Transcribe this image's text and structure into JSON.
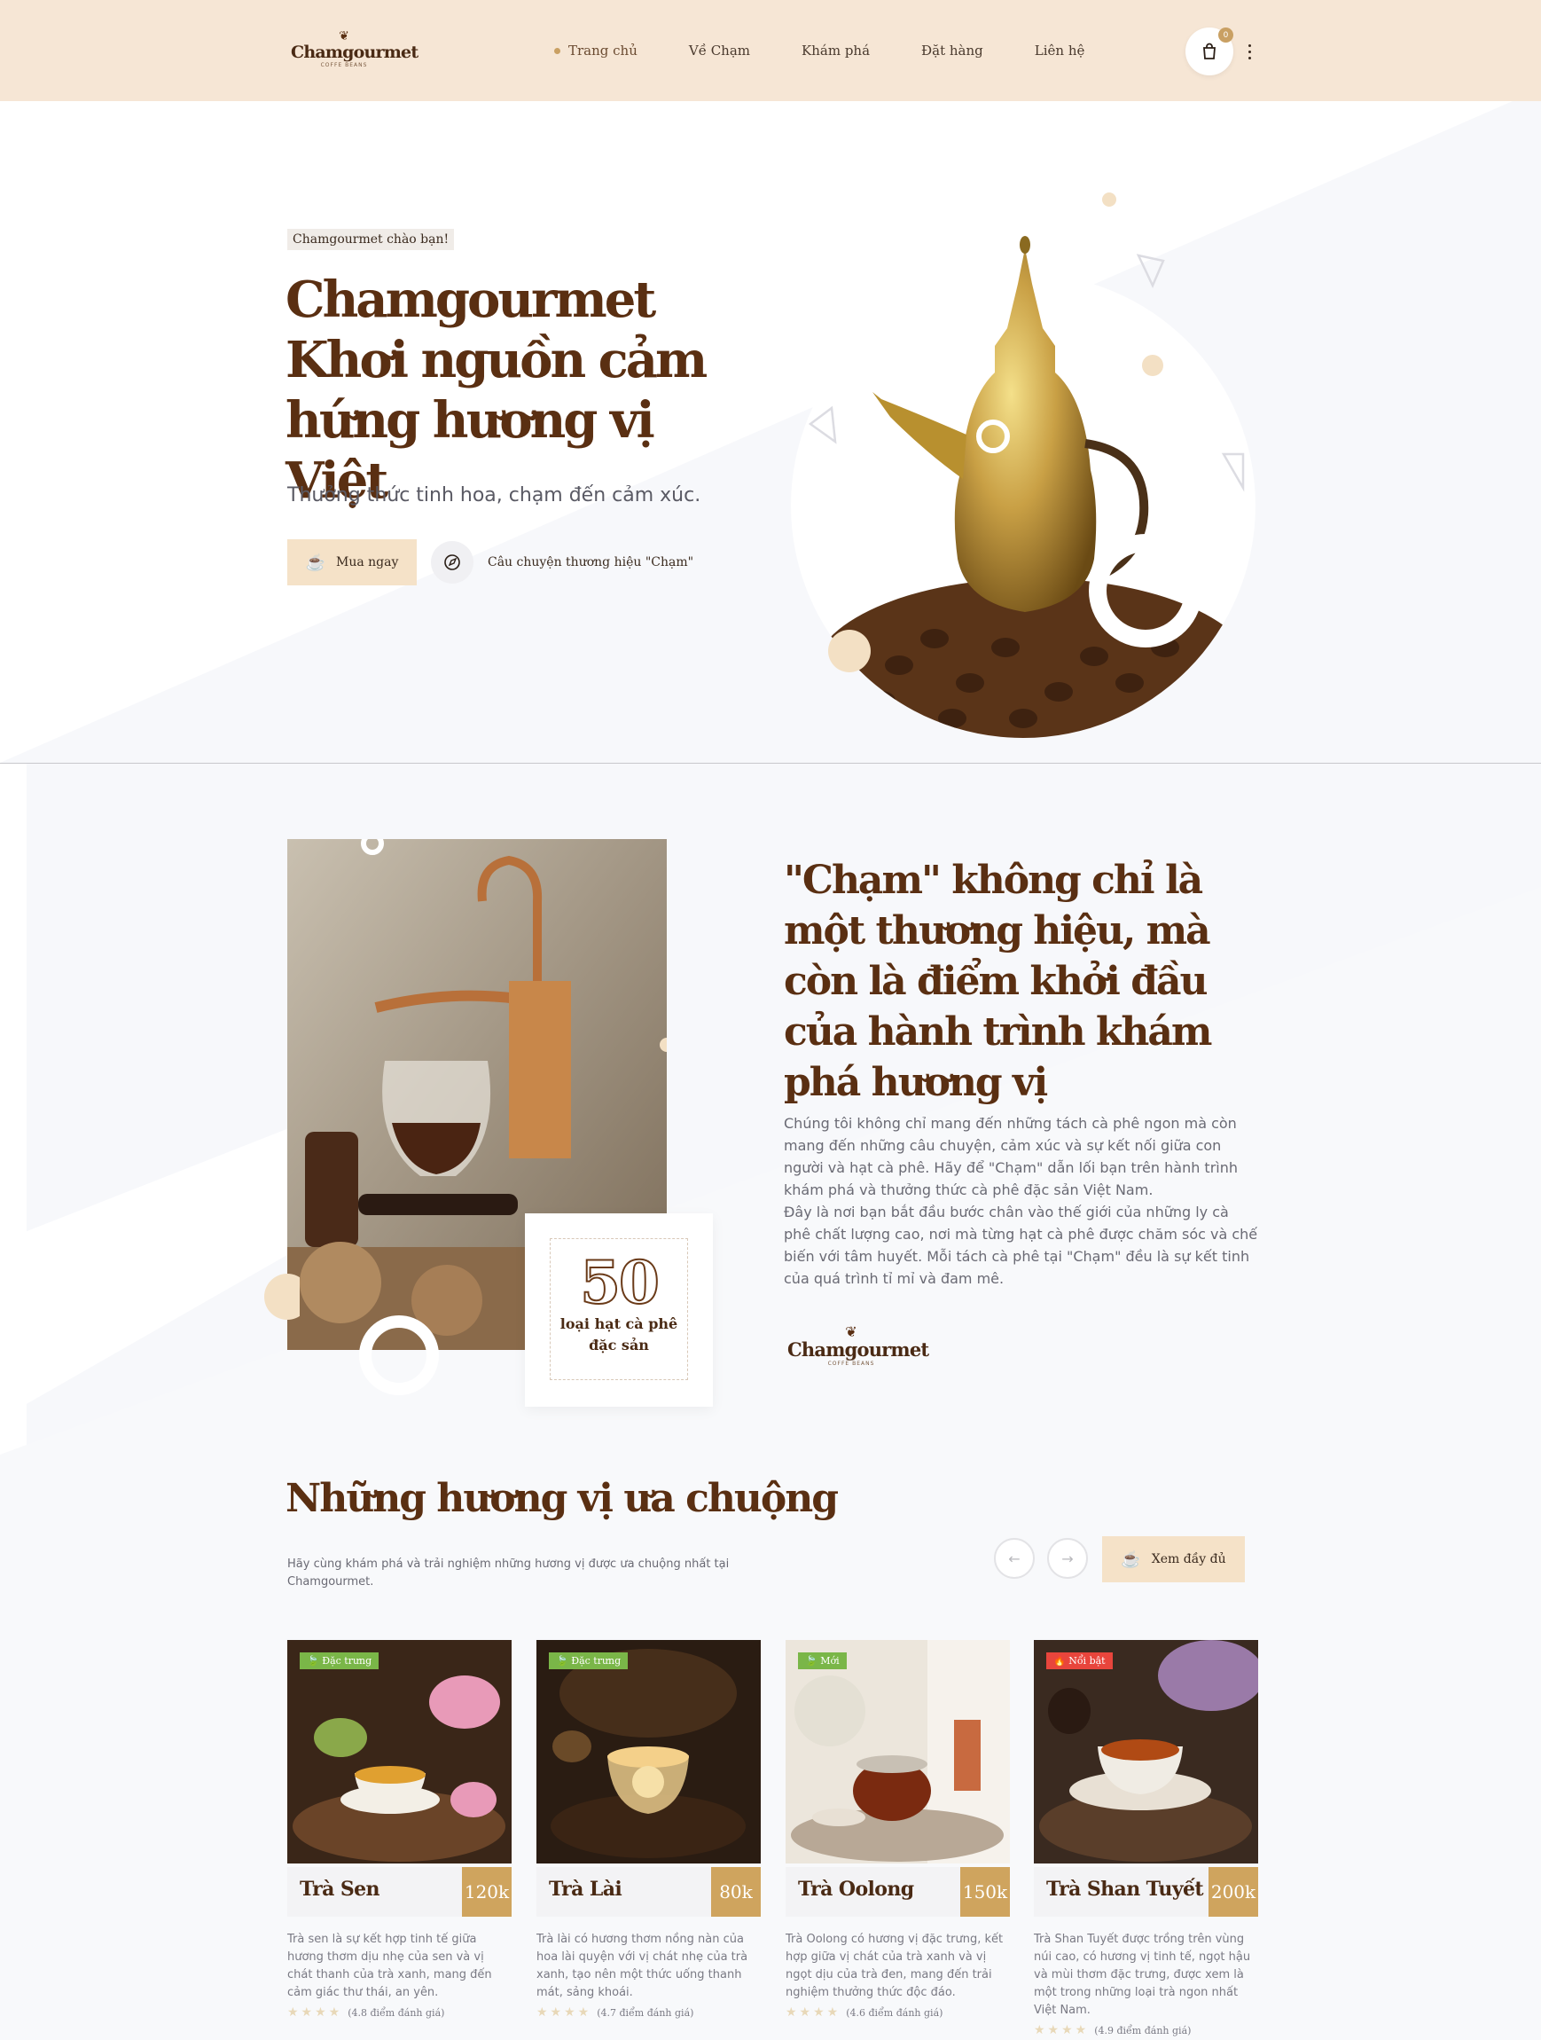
{
  "header": {
    "logo": {
      "name": "Chamgourmet",
      "tagline": "COFFE BEANS"
    },
    "nav": [
      {
        "label": "Trang chủ",
        "active": true
      },
      {
        "label": "Về Chạm",
        "active": false
      },
      {
        "label": "Khám phá",
        "active": false
      },
      {
        "label": "Đặt hàng",
        "active": false
      },
      {
        "label": "Liên hệ",
        "active": false
      }
    ],
    "cart_count": "0"
  },
  "hero": {
    "greeting": "Chamgourmet chào bạn!",
    "title_lines": [
      "Chamgourmet",
      "Khơi nguồn cảm",
      "hứng hương vị Việt"
    ],
    "subtitle": "Thưởng thức tinh hoa, chạm đến cảm xúc.",
    "buy_button": "Mua ngay",
    "story_link": "Câu chuyện thương hiệu \"Chạm\""
  },
  "about": {
    "title": "\"Chạm\" không chỉ là một thương hiệu, mà còn là điểm khởi đầu của hành trình khám phá hương vị",
    "paragraph_1": "Chúng tôi không chỉ mang đến những tách cà phê ngon mà còn mang đến những câu chuyện, cảm xúc và sự kết nối giữa con người và hạt cà phê. Hãy để \"Chạm\" dẫn lối bạn trên hành trình khám phá và thưởng thức cà phê đặc sản Việt Nam.",
    "paragraph_2": "Đây là nơi bạn bắt đầu bước chân vào thế giới của những ly cà phê chất lượng cao, nơi mà từng hạt cà phê được chăm sóc và chế biến với tâm huyết. Mỗi tách cà phê tại \"Chạm\" đều là sự kết tinh của quá trình tỉ mỉ và đam mê.",
    "stat_number": "50",
    "stat_label": "loại hạt cà phê đặc sản",
    "logo_name": "Chamgourmet",
    "logo_tagline": "COFFE BEANS"
  },
  "products_section": {
    "title": "Những hương vị ưa chuộng",
    "subtitle": "Hãy cùng khám phá và trải nghiệm những hương vị được ưa chuộng nhất tại Chamgourmet.",
    "prev_icon": "arrow-left-icon",
    "next_icon": "arrow-right-icon",
    "view_all": "Xem đầy đủ",
    "items": [
      {
        "badge": "Đặc trưng",
        "badge_color": "#7ab648",
        "name": "Trà Sen",
        "price": "120k",
        "desc": "Trà sen là sự kết hợp tinh tế giữa hương thơm dịu nhẹ của sen và vị chát thanh của trà xanh, mang đến cảm giác thư thái, an yên.",
        "stars": 4,
        "rating_text": "(4.8 điểm đánh giá)"
      },
      {
        "badge": "Đặc trưng",
        "badge_color": "#7ab648",
        "name": "Trà Lài",
        "price": "80k",
        "desc": "Trà lài có hương thơm nồng nàn của hoa lài quyện với vị chát nhẹ của trà xanh, tạo nên một thức uống thanh mát, sảng khoái.",
        "stars": 4,
        "rating_text": "(4.7 điểm đánh giá)"
      },
      {
        "badge": "Mới",
        "badge_color": "#7ab648",
        "name": "Trà Oolong",
        "price": "150k",
        "desc": "Trà Oolong có hương vị đặc trưng, kết hợp giữa vị chát của trà xanh và vị ngọt dịu của trà đen, mang đến trải nghiệm thưởng thức độc đáo.",
        "stars": 4,
        "rating_text": "(4.6 điểm đánh giá)"
      },
      {
        "badge": "Nổi bật",
        "badge_color": "#e8453c",
        "name": "Trà Shan Tuyết",
        "price": "200k",
        "desc": "Trà Shan Tuyết được trồng trên vùng núi cao, có hương vị tinh tế, ngọt hậu và mùi thơm đặc trưng, được xem là một trong những loại trà ngon nhất Việt Nam.",
        "stars": 4,
        "rating_text": "(4.9 điểm đánh giá)"
      }
    ]
  },
  "colors": {
    "header_bg": "#f6e6d5",
    "brand_brown": "#5a2f12",
    "accent_gold": "#cfa45e",
    "button_bg": "#f5e2c8"
  }
}
